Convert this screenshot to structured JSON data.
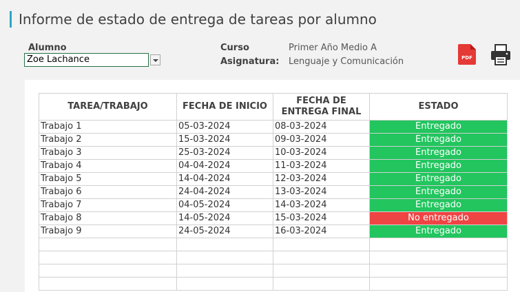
{
  "header": {
    "title": "Informe de estado de entrega de tareas por alumno"
  },
  "student": {
    "label": "Alumno",
    "value": "Zoe Lachance"
  },
  "course": {
    "label": "Curso",
    "value": "Primer Año Medio A"
  },
  "subject": {
    "label": "Asignatura:",
    "value": "Lenguaje y Comunicación"
  },
  "icons": {
    "pdf": "pdf-icon",
    "pdf_text": "PDF",
    "print": "printer-icon"
  },
  "colors": {
    "accent": "#2aa7c9",
    "delivered": "#22c55e",
    "not_delivered": "#ef4444",
    "pdf": "#e53935"
  },
  "table": {
    "headers": [
      "TAREA/TRABAJO",
      "FECHA DE INICIO",
      "FECHA DE ENTREGA FINAL",
      "ESTADO"
    ],
    "rows": [
      [
        "Trabajo 1",
        "05-03-2024",
        "08-03-2024",
        "Entregado"
      ],
      [
        "Trabajo 2",
        "15-03-2024",
        "09-03-2024",
        "Entregado"
      ],
      [
        "Trabajo 3",
        "25-03-2024",
        "10-03-2024",
        "Entregado"
      ],
      [
        "Trabajo 4",
        "04-04-2024",
        "11-03-2024",
        "Entregado"
      ],
      [
        "Trabajo 5",
        "14-04-2024",
        "12-03-2024",
        "Entregado"
      ],
      [
        "Trabajo 6",
        "24-04-2024",
        "13-03-2024",
        "Entregado"
      ],
      [
        "Trabajo 7",
        "04-05-2024",
        "14-03-2024",
        "Entregado"
      ],
      [
        "Trabajo 8",
        "14-05-2024",
        "15-03-2024",
        "No entregado"
      ],
      [
        "Trabajo 9",
        "24-05-2024",
        "16-03-2024",
        "Entregado"
      ]
    ]
  }
}
